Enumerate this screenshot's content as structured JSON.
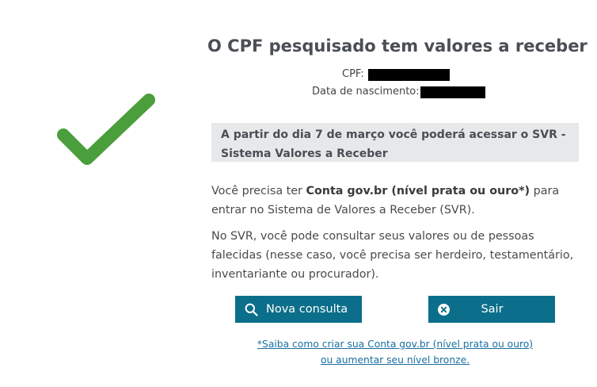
{
  "result": {
    "title": "O CPF pesquisado tem valores a receber",
    "cpf_label": "CPF:",
    "dob_label": "Data de nascimento:"
  },
  "notice": {
    "text": "A partir do dia 7 de março você poderá acessar o SVR - Sistema Valores a Receber"
  },
  "body": {
    "p1_before": "Você precisa ter ",
    "p1_bold": "Conta gov.br (nível prata ou ouro*)",
    "p1_after": " para entrar no Sistema de Valores a Receber (SVR).",
    "p2": "No SVR, você pode consultar seus valores ou de pessoas falecidas (nesse caso, você precisa ser herdeiro, testamentário, inventariante ou procurador)."
  },
  "actions": {
    "nova_consulta": "Nova consulta",
    "sair": "Sair"
  },
  "help_link": {
    "line1": "*Saiba como criar sua Conta gov.br (nível prata ou ouro)",
    "line2": "ou aumentar seu nível bronze."
  },
  "icons": {
    "success": "checkmark-icon",
    "search": "search-icon",
    "close": "close-circle-icon"
  },
  "colors": {
    "check": "#4a9e3b",
    "button_bg": "#0b6e8a",
    "notice_bg": "#e6e8ea",
    "link": "#1a6fa0"
  }
}
